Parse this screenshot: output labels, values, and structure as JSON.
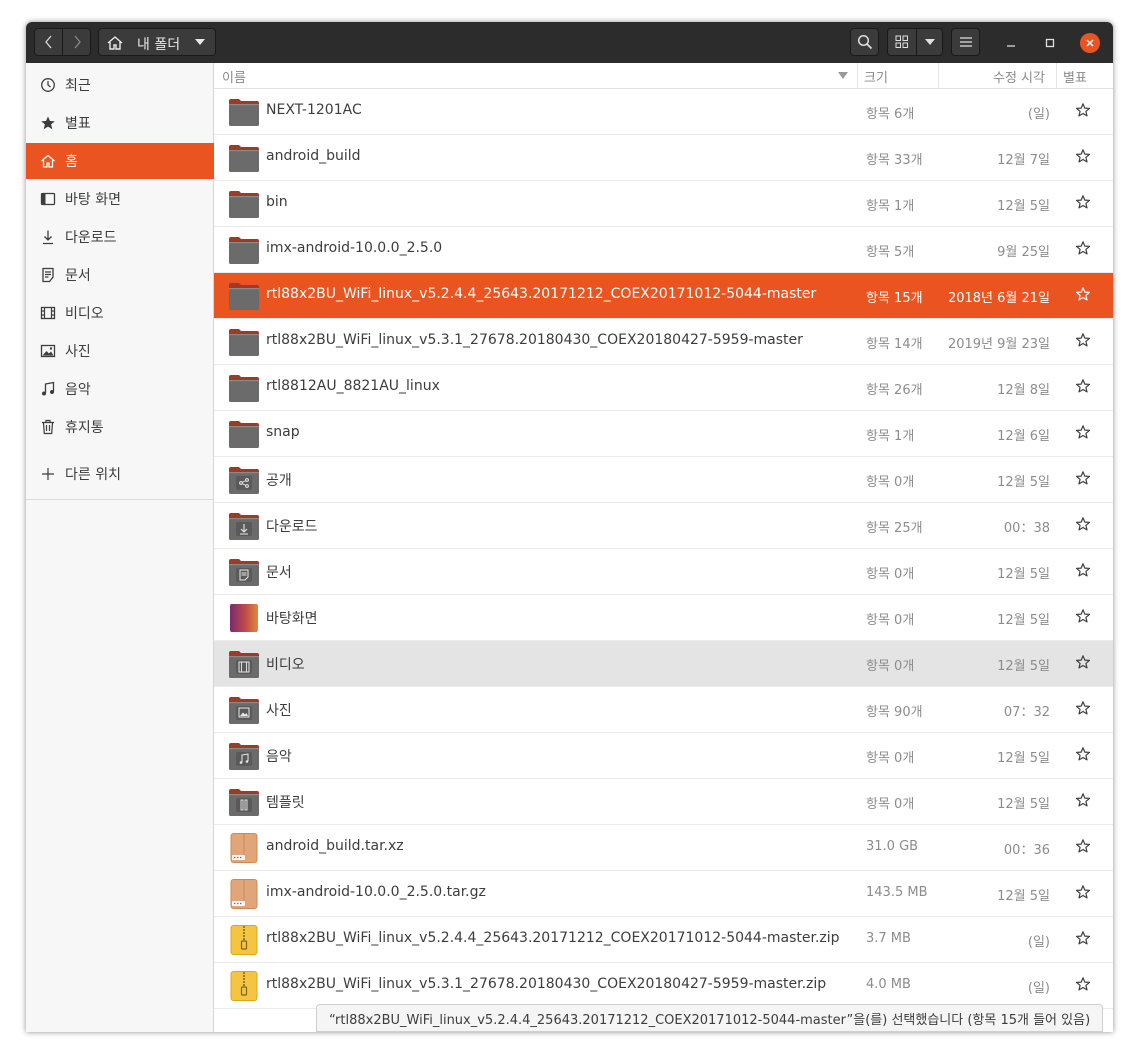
{
  "header": {
    "back_icon": "chevron-left-icon",
    "forward_icon": "chevron-right-icon",
    "path_label": "내 폴더",
    "path_icon": "home-icon",
    "search_icon": "search-icon",
    "view_icon": "grid-view-icon",
    "menu_icon": "hamburger-icon"
  },
  "sidebar": {
    "items": [
      {
        "label": "최근",
        "icon": "clock-icon"
      },
      {
        "label": "별표",
        "icon": "star-icon"
      },
      {
        "label": "홈",
        "icon": "home-icon"
      },
      {
        "label": "바탕 화면",
        "icon": "desktop-icon"
      },
      {
        "label": "다운로드",
        "icon": "download-icon"
      },
      {
        "label": "문서",
        "icon": "document-icon"
      },
      {
        "label": "비디오",
        "icon": "video-icon"
      },
      {
        "label": "사진",
        "icon": "picture-icon"
      },
      {
        "label": "음악",
        "icon": "music-icon"
      },
      {
        "label": "휴지통",
        "icon": "trash-icon"
      }
    ],
    "other_locations": {
      "label": "다른 위치",
      "icon": "plus-icon"
    }
  },
  "columns": {
    "name": "이름",
    "size": "크기",
    "modified": "수정 시각",
    "star": "별표"
  },
  "files": [
    {
      "name": "NEXT-1201AC",
      "size": "항목 6개",
      "modified": "(일)",
      "kind": "folder"
    },
    {
      "name": "android_build",
      "size": "항목 33개",
      "modified": "12월 7일",
      "kind": "folder"
    },
    {
      "name": "bin",
      "size": "항목 1개",
      "modified": "12월 5일",
      "kind": "folder"
    },
    {
      "name": "imx-android-10.0.0_2.5.0",
      "size": "항목 5개",
      "modified": "9월 25일",
      "kind": "folder"
    },
    {
      "name": "rtl88x2BU_WiFi_linux_v5.2.4.4_25643.20171212_COEX20171012-5044-master",
      "size": "항목 15개",
      "modified": "2018년 6월 21일",
      "kind": "folder"
    },
    {
      "name": "rtl88x2BU_WiFi_linux_v5.3.1_27678.20180430_COEX20180427-5959-master",
      "size": "항목 14개",
      "modified": "2019년 9월 23일",
      "kind": "folder"
    },
    {
      "name": "rtl8812AU_8821AU_linux",
      "size": "항목 26개",
      "modified": "12월 8일",
      "kind": "folder"
    },
    {
      "name": "snap",
      "size": "항목 1개",
      "modified": "12월 6일",
      "kind": "folder"
    },
    {
      "name": "공개",
      "size": "항목 0개",
      "modified": "12월 5일",
      "kind": "folder-share"
    },
    {
      "name": "다운로드",
      "size": "항목 25개",
      "modified": "00：38",
      "kind": "folder-download"
    },
    {
      "name": "문서",
      "size": "항목 0개",
      "modified": "12월 5일",
      "kind": "folder-document"
    },
    {
      "name": "바탕화면",
      "size": "항목 0개",
      "modified": "12월 5일",
      "kind": "folder-desktop"
    },
    {
      "name": "비디오",
      "size": "항목 0개",
      "modified": "12월 5일",
      "kind": "folder-video"
    },
    {
      "name": "사진",
      "size": "항목 90개",
      "modified": "07：32",
      "kind": "folder-picture"
    },
    {
      "name": "음악",
      "size": "항목 0개",
      "modified": "12월 5일",
      "kind": "folder-music"
    },
    {
      "name": "템플릿",
      "size": "항목 0개",
      "modified": "12월 5일",
      "kind": "folder-template"
    },
    {
      "name": "android_build.tar.xz",
      "size": "31.0 GB",
      "modified": "00：36",
      "kind": "archive"
    },
    {
      "name": "imx-android-10.0.0_2.5.0.tar.gz",
      "size": "143.5 MB",
      "modified": "12월 5일",
      "kind": "archive"
    },
    {
      "name": "rtl88x2BU_WiFi_linux_v5.2.4.4_25643.20171212_COEX20171012-5044-master.zip",
      "size": "3.7 MB",
      "modified": "(일)",
      "kind": "zip"
    },
    {
      "name": "rtl88x2BU_WiFi_linux_v5.3.1_27678.20180430_COEX20180427-5959-master.zip",
      "size": "4.0 MB",
      "modified": "(일)",
      "kind": "zip"
    }
  ],
  "selected_index": 4,
  "hover_index": 12,
  "active_sidebar_index": 2,
  "status": "“rtl88x2BU_WiFi_linux_v5.2.4.4_25643.20171212_COEX20171012-5044-master”을(를) 선택했습니다 (항목 15개 들어 있음)",
  "colors": {
    "accent": "#e95420",
    "headerbar": "#2c2c2c",
    "folder": "#6b6b6b",
    "folder_tab": "#a03a28"
  }
}
